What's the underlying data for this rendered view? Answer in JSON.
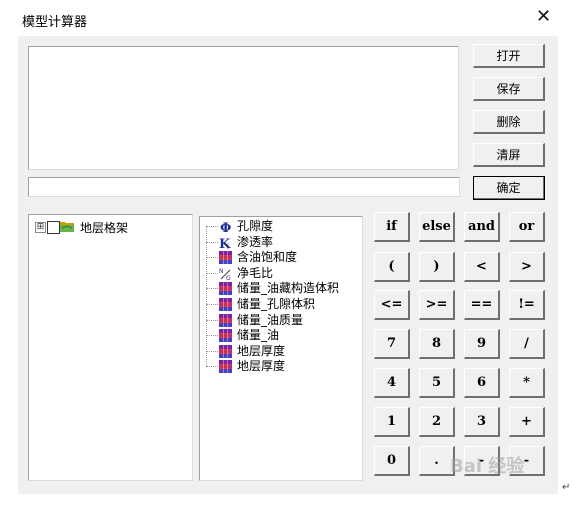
{
  "window": {
    "title": "模型计算器",
    "close_glyph": "✕"
  },
  "side_buttons": {
    "open": "打开",
    "save": "保存",
    "delete": "删除",
    "clear": "清屏",
    "confirm": "确定"
  },
  "expression_input": {
    "value": ""
  },
  "layer_tree": {
    "expander": "⊞",
    "root": "地层格架"
  },
  "fields": [
    {
      "label": "孔隙度",
      "icon": "phi-icon"
    },
    {
      "label": "渗透率",
      "icon": "k-icon"
    },
    {
      "label": "含油饱和度",
      "icon": "grid-icon"
    },
    {
      "label": "净毛比",
      "icon": "ratio-icon"
    },
    {
      "label": "储量_油藏构造体积",
      "icon": "grid-icon"
    },
    {
      "label": "储量_孔隙体积",
      "icon": "grid-icon"
    },
    {
      "label": "储量_油质量",
      "icon": "grid-icon"
    },
    {
      "label": "储量_油",
      "icon": "grid-icon"
    },
    {
      "label": "地层厚度",
      "icon": "grid-icon"
    },
    {
      "label": "地层厚度",
      "icon": "grid-icon"
    }
  ],
  "keypad": [
    [
      "if",
      "else",
      "and",
      "or"
    ],
    [
      "(",
      ")",
      "<",
      ">"
    ],
    [
      "<=",
      ">=",
      "==",
      "!="
    ],
    [
      "7",
      "8",
      "9",
      "/"
    ],
    [
      "4",
      "5",
      "6",
      "*"
    ],
    [
      "1",
      "2",
      "3",
      "+"
    ],
    [
      "0",
      ".",
      "-",
      "-"
    ]
  ],
  "watermark_text": "Bai 经验",
  "return_mark": "↵"
}
